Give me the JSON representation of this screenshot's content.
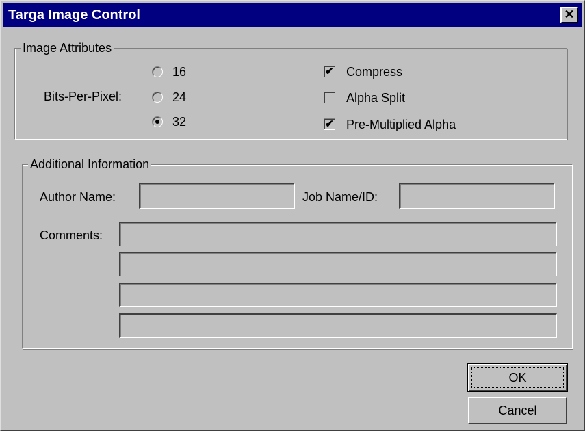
{
  "window": {
    "title": "Targa Image Control",
    "close_glyph": "✕"
  },
  "image_attributes": {
    "legend": "Image Attributes",
    "bpp_label": "Bits-Per-Pixel:",
    "bpp_options": [
      {
        "label": "16",
        "checked": false
      },
      {
        "label": "24",
        "checked": false
      },
      {
        "label": "32",
        "checked": true
      }
    ],
    "checkboxes": [
      {
        "label": "Compress",
        "checked": true
      },
      {
        "label": "Alpha Split",
        "checked": false
      },
      {
        "label": "Pre-Multiplied Alpha",
        "checked": true
      }
    ]
  },
  "additional_info": {
    "legend": "Additional Information",
    "author_label": "Author Name:",
    "author_value": "",
    "job_label": "Job Name/ID:",
    "job_value": "",
    "comments_label": "Comments:",
    "comments": [
      "",
      "",
      "",
      ""
    ]
  },
  "buttons": {
    "ok": "OK",
    "cancel": "Cancel"
  },
  "icons": {
    "check_glyph": "✔",
    "close": "close-icon"
  },
  "colors": {
    "titlebar": "#000080",
    "face": "#c0c0c0"
  }
}
